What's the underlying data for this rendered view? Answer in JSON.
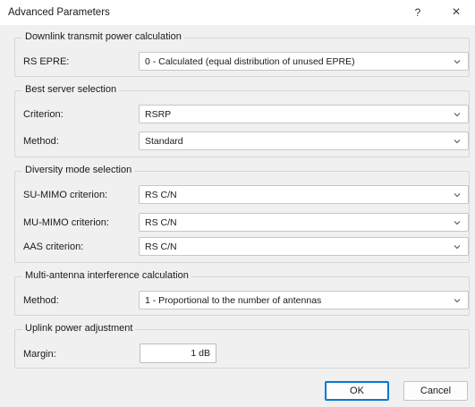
{
  "window": {
    "title": "Advanced Parameters",
    "help_glyph": "?",
    "close_glyph": "×"
  },
  "groups": {
    "downlink": {
      "title": "Downlink transmit power calculation",
      "rs_epre_label": "RS EPRE:",
      "rs_epre_value": "0 - Calculated (equal distribution of unused EPRE)"
    },
    "best_server": {
      "title": "Best server selection",
      "criterion_label": "Criterion:",
      "criterion_value": "RSRP",
      "method_label": "Method:",
      "method_value": "Standard"
    },
    "diversity": {
      "title": "Diversity mode selection",
      "su_label": "SU-MIMO criterion:",
      "su_value": "RS C/N",
      "mu_label": "MU-MIMO criterion:",
      "mu_value": "RS C/N",
      "aas_label": "AAS criterion:",
      "aas_value": "RS C/N"
    },
    "multi_antenna": {
      "title": "Multi-antenna interference calculation",
      "method_label": "Method:",
      "method_value": "1 - Proportional to the number of antennas"
    },
    "uplink": {
      "title": "Uplink power adjustment",
      "margin_label": "Margin:",
      "margin_value": "1 dB"
    }
  },
  "buttons": {
    "ok": "OK",
    "cancel": "Cancel"
  },
  "icons": {
    "dropdown": "chevron-down-icon"
  }
}
